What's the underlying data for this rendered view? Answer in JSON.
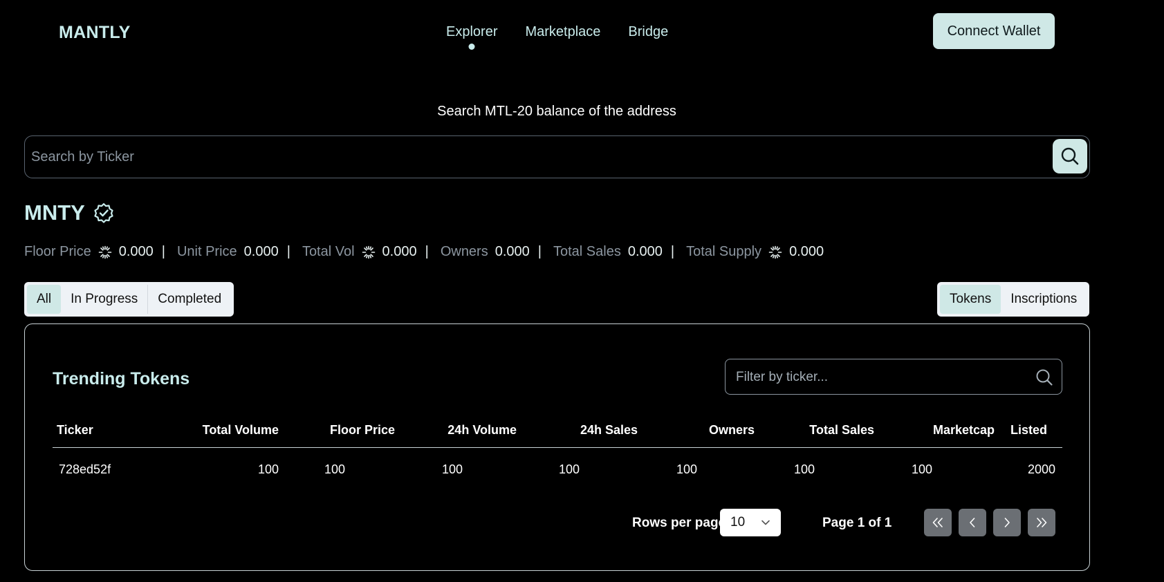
{
  "header": {
    "logo": "MANTLY",
    "nav": [
      {
        "label": "Explorer",
        "active": true
      },
      {
        "label": "Marketplace",
        "active": false
      },
      {
        "label": "Bridge",
        "active": false
      }
    ],
    "connect_label": "Connect Wallet"
  },
  "search": {
    "title": "Search MTL-20 balance of the address",
    "placeholder": "Search by Ticker"
  },
  "token": {
    "name": "MNTY",
    "verified_icon": "verified-badge-icon",
    "stats": [
      {
        "label": "Floor Price",
        "icon": "spinner-icon",
        "value": "0.000"
      },
      {
        "label": "Unit Price",
        "icon": null,
        "value": "0.000"
      },
      {
        "label": "Total Vol",
        "icon": "spinner-icon",
        "value": "0.000"
      },
      {
        "label": "Owners",
        "icon": null,
        "value": "0.000"
      },
      {
        "label": "Total Sales",
        "icon": null,
        "value": "0.000"
      },
      {
        "label": "Total Supply",
        "icon": "spinner-icon",
        "value": "0.000"
      }
    ],
    "separator": "|"
  },
  "status_tabs": [
    {
      "label": "All",
      "active": true
    },
    {
      "label": "In Progress",
      "active": false
    },
    {
      "label": "Completed",
      "active": false
    }
  ],
  "type_tabs": [
    {
      "label": "Tokens",
      "active": true
    },
    {
      "label": "Inscriptions",
      "active": false
    }
  ],
  "table": {
    "title": "Trending Tokens",
    "filter_placeholder": "Filter by ticker...",
    "columns": [
      "Ticker",
      "Total Volume",
      "Floor Price",
      "24h Volume",
      "24h Sales",
      "Owners",
      "Total Sales",
      "Marketcap",
      "Listed"
    ],
    "rows": [
      [
        "728ed52f",
        "100",
        "100",
        "100",
        "100",
        "100",
        "100",
        "100",
        "2000"
      ]
    ],
    "rows_per_page_label": "Rows per page",
    "rows_per_page_value": "10",
    "page_info": "Page 1 of 1",
    "pager_buttons": [
      "first-page",
      "previous-page",
      "next-page",
      "last-page"
    ]
  },
  "colors": {
    "background": "#000000",
    "accent": "#cfe8e6",
    "heading": "#c9ecec",
    "muted": "#8c96a0"
  }
}
